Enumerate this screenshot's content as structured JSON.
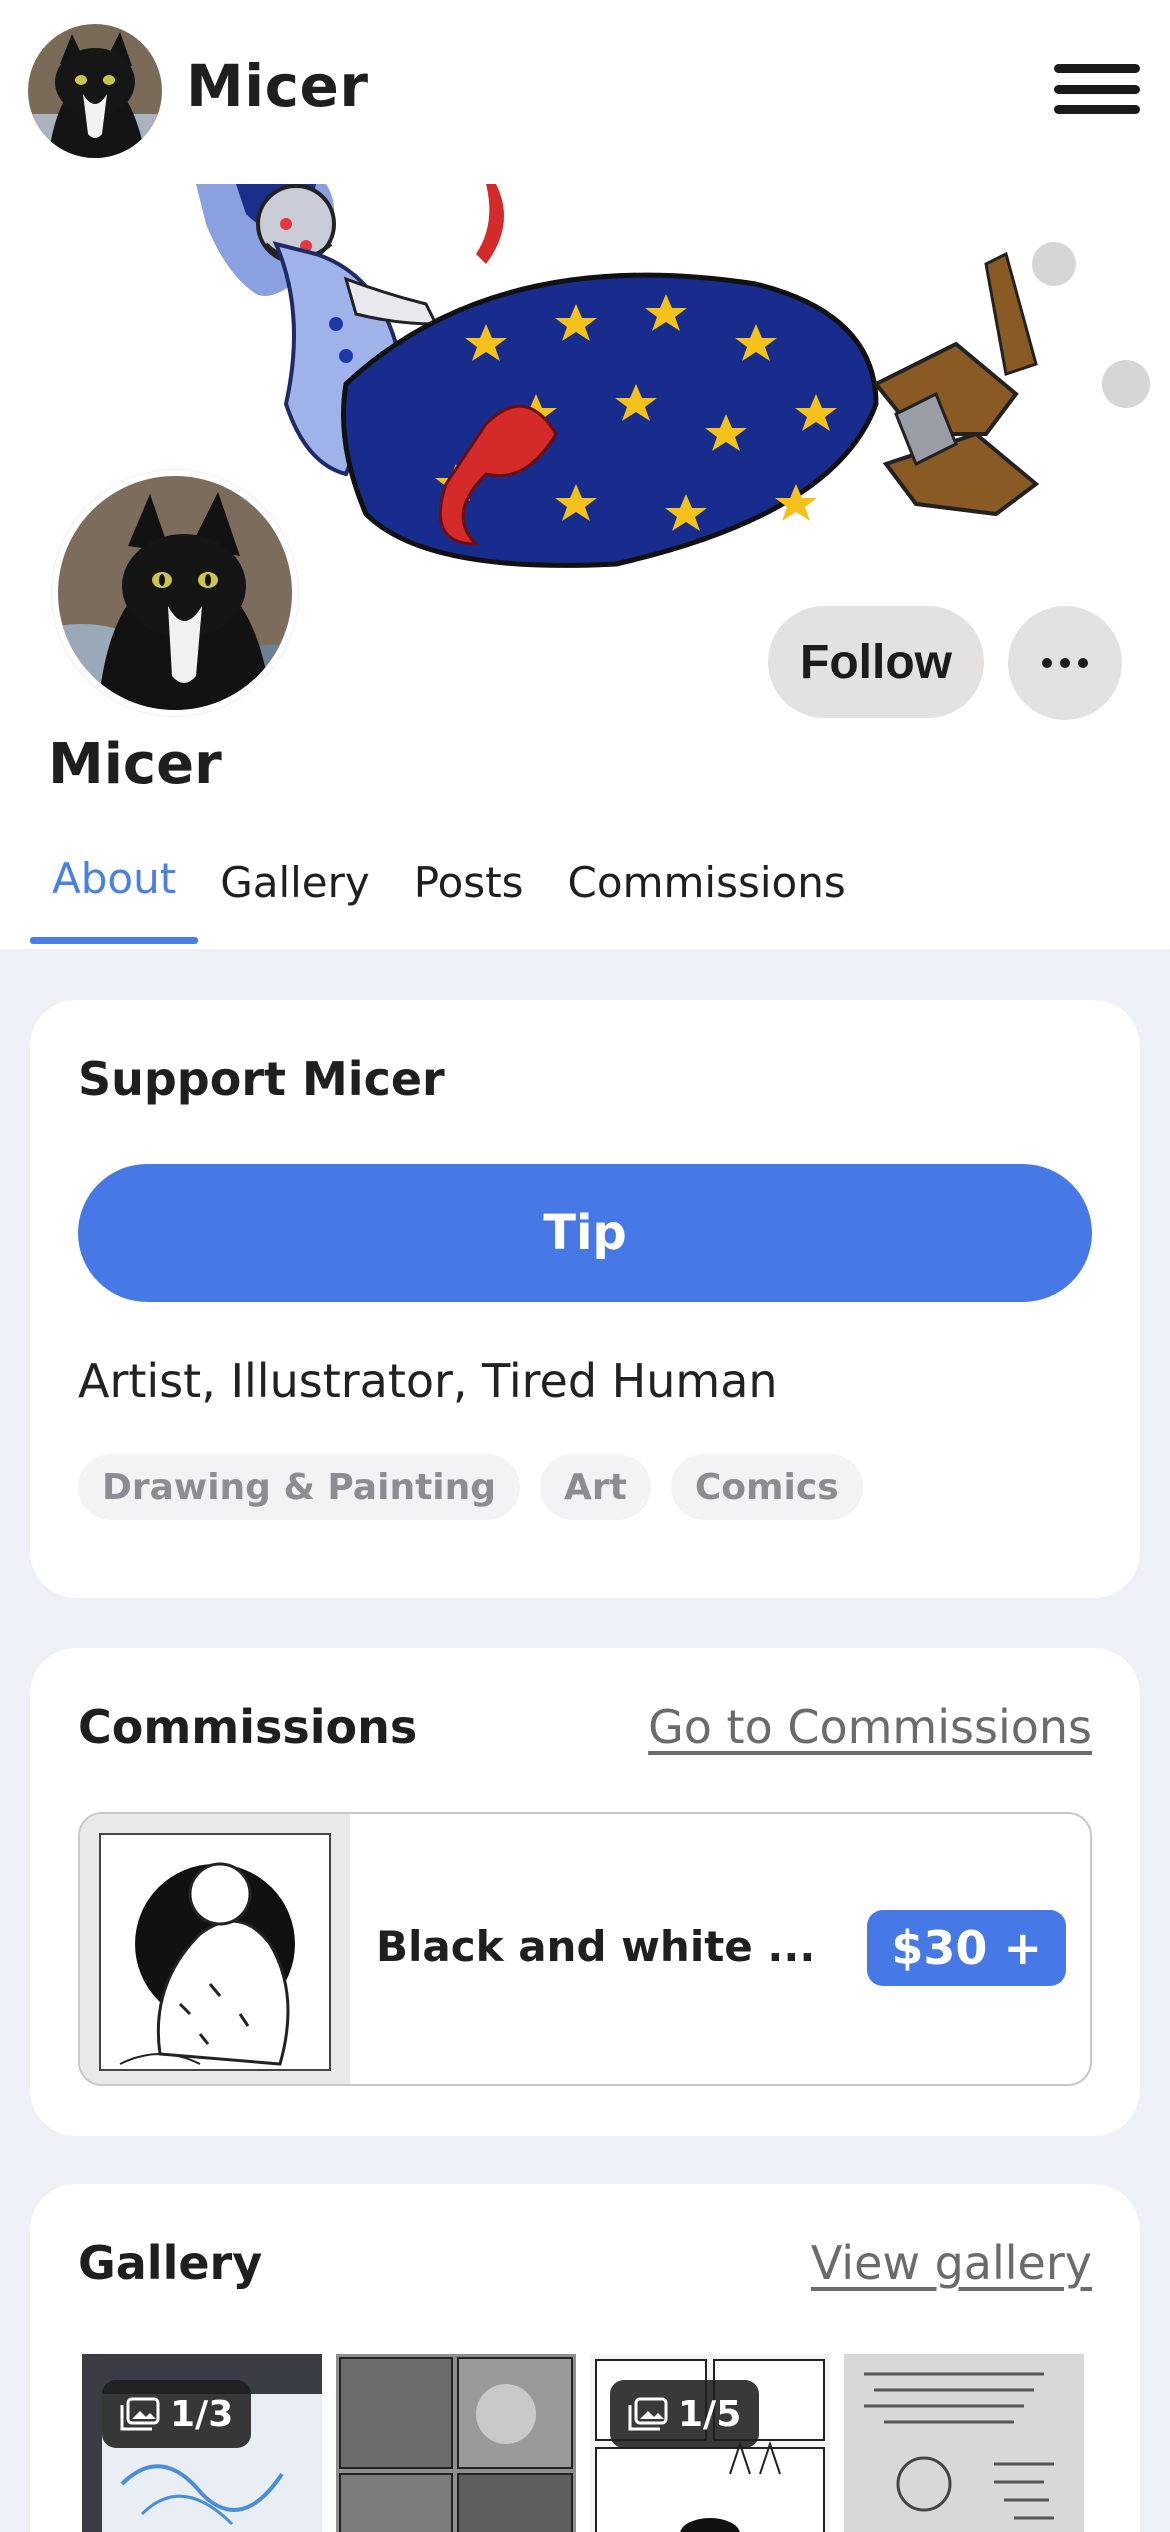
{
  "header": {
    "username": "Micer"
  },
  "profile": {
    "name": "Micer",
    "follow_label": "Follow",
    "tabs": [
      {
        "label": "About",
        "active": true
      },
      {
        "label": "Gallery"
      },
      {
        "label": "Posts"
      },
      {
        "label": "Commissions"
      }
    ]
  },
  "support": {
    "title": "Support Micer",
    "tip_label": "Tip",
    "bio": "Artist, Illustrator, Tired Human",
    "tags": [
      "Drawing & Painting",
      "Art",
      "Comics"
    ]
  },
  "commissions": {
    "title": "Commissions",
    "link": "Go to Commissions",
    "items": [
      {
        "title": "Black and white ...",
        "price": "$30 +"
      }
    ]
  },
  "gallery": {
    "title": "Gallery",
    "link": "View gallery",
    "items": [
      {
        "badge": "1/3"
      },
      {
        "badge": ""
      },
      {
        "badge": "1/5"
      },
      {
        "badge": ""
      }
    ]
  },
  "colors": {
    "accent": "#4779e6",
    "tab_active": "#4a7fe3",
    "page_bg": "#edf0f6"
  },
  "icons": [
    "menu-icon",
    "more-options-icon",
    "image-stack-icon"
  ]
}
